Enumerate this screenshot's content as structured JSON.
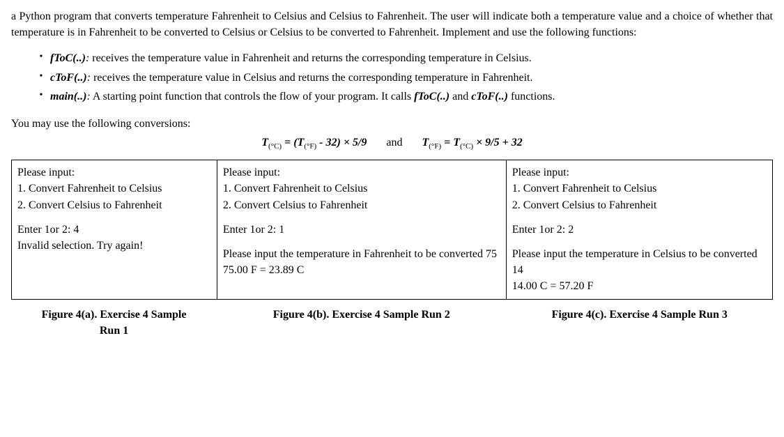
{
  "intro": "a Python program that converts temperature Fahrenheit to Celsius and Celsius to Fahrenheit. The user will indicate both a temperature value and a choice of whether that temperature is in Fahrenheit to be converted to Celsius or Celsius to be converted to Fahrenheit. Implement and use the following functions:",
  "bullets": [
    {
      "fn": "fToC(..)",
      "sep": ":",
      "desc": " receives the temperature value in Fahrenheit and returns the corresponding temperature in Celsius."
    },
    {
      "fn": "cToF(..)",
      "sep": ":",
      "desc": " receives the temperature value in Celsius and returns the corresponding temperature in Fahrenheit."
    },
    {
      "fn": "main(..)",
      "sep": ":",
      "desc_prefix": " A starting point function that controls the flow of your program. It calls ",
      "call1": "fToC(..)",
      "mid": " and ",
      "call2": "cToF(..)",
      "desc_suffix": " functions."
    }
  ],
  "conv_intro": "You may use the following conversions:",
  "formula": {
    "left_pre": "T",
    "left_sub": "(°C)",
    "left_mid": " = (T",
    "left_sub2": "(°F)",
    "left_post": " - 32) × 5/9",
    "and": "and",
    "right_pre": "T",
    "right_sub": "(°F)",
    "right_mid": " = T",
    "right_sub2": "(°C)",
    "right_post": " × 9/5 + 32"
  },
  "menu": {
    "header": "Please input:",
    "opt1": "1. Convert Fahrenheit to Celsius",
    "opt2": "2. Convert Celsius to Fahrenheit"
  },
  "run_a": {
    "prompt": "Enter 1or 2: 4",
    "invalid": "Invalid selection. Try again!"
  },
  "run_b": {
    "prompt": "Enter 1or 2: 1",
    "ask": "Please input the temperature in Fahrenheit to be converted  75",
    "result": "75.00 F = 23.89 C"
  },
  "run_c": {
    "prompt": "Enter 1or 2: 2",
    "ask": "Please input the temperature in Celsius to be converted  14",
    "result": "14.00 C = 57.20 F"
  },
  "captions": {
    "a_line1": "Figure 4(a). Exercise 4 Sample",
    "a_line2": "Run 1",
    "b": "Figure 4(b). Exercise 4 Sample Run 2",
    "c": "Figure 4(c). Exercise 4 Sample Run 3"
  }
}
